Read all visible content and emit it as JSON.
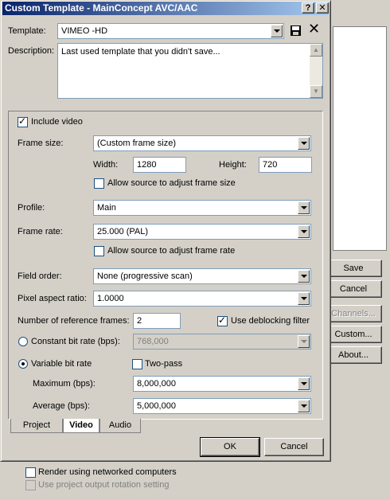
{
  "dialog": {
    "title": "Custom Template - MainConcept AVC/AAC",
    "help_button": "?",
    "template_label": "Template:",
    "template_value": "VIMEO -HD",
    "description_label": "Description:",
    "description_value": "Last used template that you didn't save..."
  },
  "video": {
    "include_video_label": "Include video",
    "frame_size_label": "Frame size:",
    "frame_size_value": "(Custom frame size)",
    "width_label": "Width:",
    "width_value": "1280",
    "height_label": "Height:",
    "height_value": "720",
    "allow_frame_size_label": "Allow source to adjust frame size",
    "profile_label": "Profile:",
    "profile_value": "Main",
    "frame_rate_label": "Frame rate:",
    "frame_rate_value": "25.000 (PAL)",
    "allow_frame_rate_label": "Allow source to adjust frame rate",
    "field_order_label": "Field order:",
    "field_order_value": "None (progressive scan)",
    "pixel_aspect_label": "Pixel aspect ratio:",
    "pixel_aspect_value": "1.0000",
    "ref_frames_label": "Number of reference frames:",
    "ref_frames_value": "2",
    "deblocking_label": "Use deblocking filter",
    "cbr_label": "Constant bit rate (bps):",
    "cbr_value": "768,000",
    "vbr_label": "Variable bit rate",
    "two_pass_label": "Two-pass",
    "maximum_label": "Maximum (bps):",
    "maximum_value": "8,000,000",
    "average_label": "Average (bps):",
    "average_value": "5,000,000"
  },
  "tabs": [
    "Project",
    "Video",
    "Audio"
  ],
  "footer": {
    "ok_label": "OK",
    "cancel_label": "Cancel"
  },
  "right_panel": {
    "save_label": "Save",
    "cancel_label": "Cancel",
    "channels_label": "Channels...",
    "custom_label": "Custom...",
    "about_label": "About..."
  },
  "bottom": {
    "render_networked_label": "Render using networked computers",
    "rotation_label": "Use project output rotation setting"
  },
  "colors": {
    "title_bar": "#0a246a",
    "dialog_bg": "#d4d0c8"
  }
}
